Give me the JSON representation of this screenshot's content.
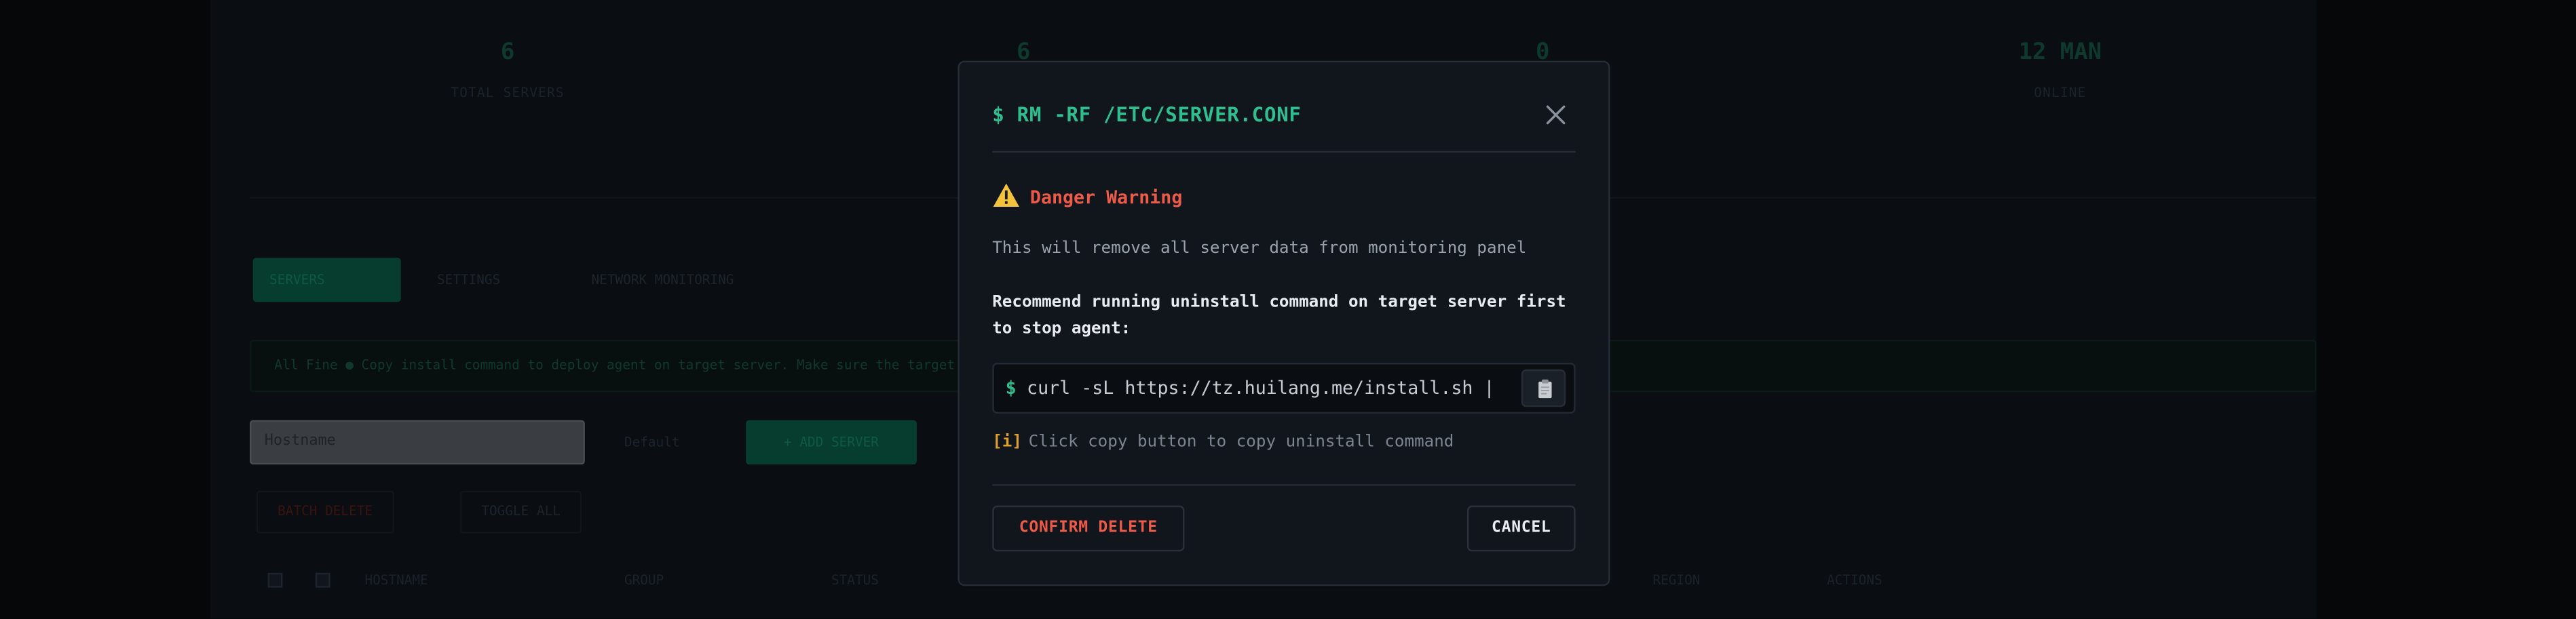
{
  "background": {
    "stats": [
      {
        "value": "6",
        "label": "TOTAL SERVERS"
      },
      {
        "value": "6",
        "label": ""
      },
      {
        "value": "0",
        "label": ""
      },
      {
        "value": "12 MAN",
        "label": "ONLINE"
      }
    ],
    "tabs": [
      "SERVERS",
      "SETTINGS",
      "NETWORK MONITORING"
    ],
    "hint": "All Fine ● Copy install command to deploy agent on target server. Make sure the target server can access panel",
    "search_value": "Hostname",
    "sort_select": "Default",
    "add_button": "+ ADD SERVER",
    "batch_delete": "BATCH DELETE",
    "toggle_all": "TOGGLE ALL",
    "table_headers": [
      "HOSTNAME",
      "GROUP",
      "STATUS",
      "REGION",
      "ACTIONS"
    ]
  },
  "modal": {
    "title": "$ RM -RF /ETC/SERVER.CONF",
    "warning_title": "Danger Warning",
    "description": "This will remove all server data from monitoring panel",
    "recommend": "Recommend running uninstall command on target server first to stop agent:",
    "code_prompt": "$",
    "code": "curl -sL https://tz.huilang.me/install.sh |",
    "hint_tag": "[i]",
    "hint_text": "Click copy button to copy uninstall command",
    "confirm_label": "CONFIRM DELETE",
    "cancel_label": "CANCEL"
  },
  "colors": {
    "accent": "#2fbf8f",
    "danger": "#ee5a48",
    "warning": "#f5c33b",
    "modal_bg": "#11161d"
  },
  "icons": {
    "close": "close-icon",
    "warning": "warning-triangle-icon",
    "copy": "clipboard-icon"
  }
}
